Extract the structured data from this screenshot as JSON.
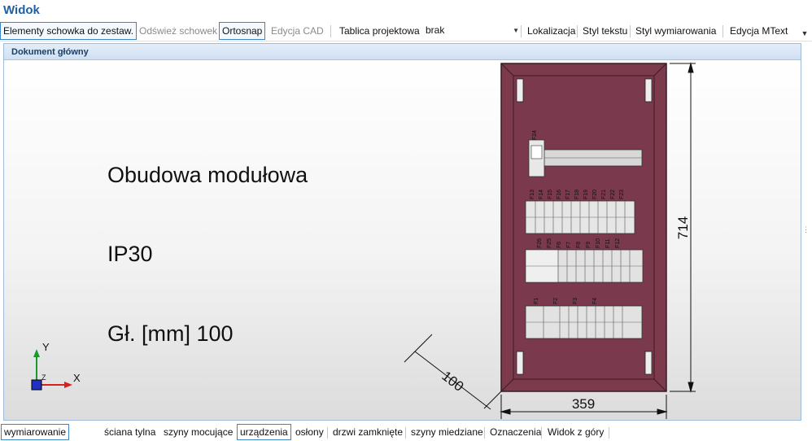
{
  "window": {
    "title": "Widok"
  },
  "toolbar": {
    "clipboard_elements": "Elementy schowka do zestaw.",
    "refresh_clipboard": "Odśwież schowek",
    "ortosnap": "Ortosnap",
    "cad_edit": "Edycja CAD",
    "project_table": "Tablica projektowa",
    "project_table_value": "brak",
    "localization": "Lokalizacja",
    "text_style": "Styl tekstu",
    "dimension_style": "Styl wymiarowania",
    "mtext_edit": "Edycja MText"
  },
  "panel": {
    "title": "Dokument główny"
  },
  "drawing": {
    "line1": "Obudowa modułowa",
    "line2": "IP30",
    "line3": "Gł. [mm] 100",
    "dim_height": "714",
    "dim_width": "359",
    "dim_depth": "100",
    "axis_y": "Y",
    "axis_x": "X",
    "axis_z": "Z",
    "row1_label": "F24",
    "row2_labels": [
      "F13",
      "F14",
      "F15",
      "F16",
      "F17",
      "F18",
      "F19",
      "F20",
      "F21",
      "F22",
      "F23"
    ],
    "row3_labels": [
      "F26",
      "F25",
      "F6",
      "F7",
      "F8",
      "F9",
      "F10",
      "F11",
      "F12"
    ],
    "row4_labels": [
      "F1",
      "F2",
      "F3",
      "F4"
    ],
    "colors": {
      "enclosure": "#7d3a4d",
      "enclosure_edge": "#5c2636",
      "rail": "#d8d8d8"
    }
  },
  "tabs": [
    {
      "label": "wymiarowanie",
      "active": true
    },
    {
      "label": "ściana tylna",
      "active": false
    },
    {
      "label": "szyny mocujące",
      "active": false
    },
    {
      "label": "urządzenia",
      "active": true
    },
    {
      "label": "osłony",
      "active": false
    },
    {
      "label": "drzwi zamknięte",
      "active": false
    },
    {
      "label": "szyny miedziane",
      "active": false
    },
    {
      "label": "Oznaczenia",
      "active": false
    },
    {
      "label": "Widok z góry",
      "active": false
    }
  ]
}
